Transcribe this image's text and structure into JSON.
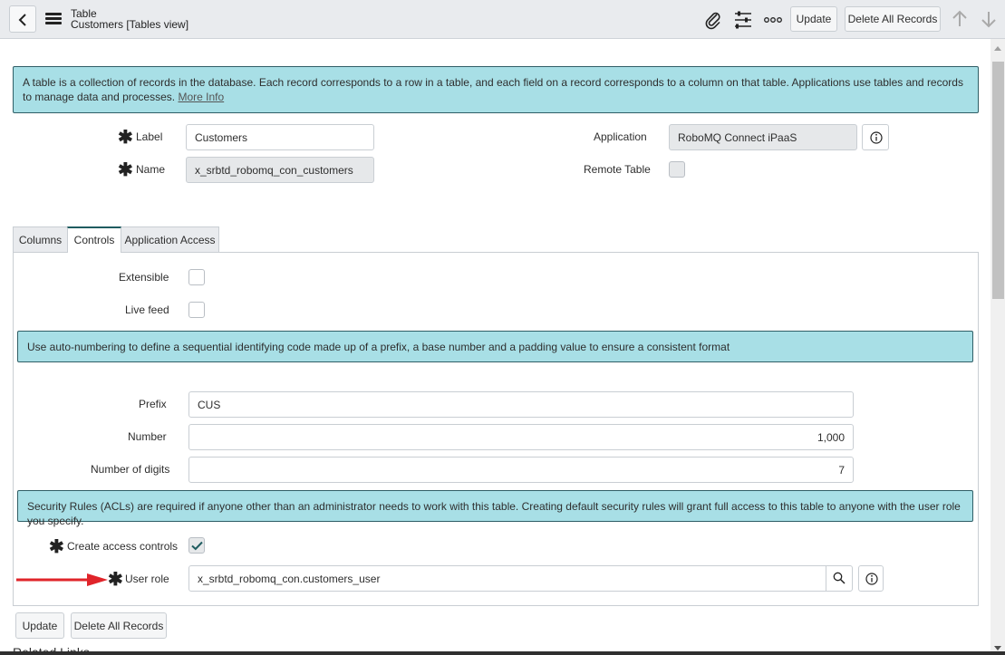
{
  "header": {
    "title": "Table",
    "subtitle": "Customers [Tables view]",
    "icons": [
      "back-icon",
      "menu-icon",
      "paperclip-icon",
      "sliders-icon",
      "more-icon",
      "arrow-up-icon",
      "arrow-down-icon"
    ],
    "update_label": "Update",
    "delete_all_label": "Delete All Records"
  },
  "info_top": {
    "text": "A table is a collection of records in the database. Each record corresponds to a row in a table, and each field on a record corresponds to a column on that table. Applications use tables and records to manage data and processes.",
    "link": "More Info"
  },
  "form": {
    "label_label": "Label",
    "label_value": "Customers",
    "name_label": "Name",
    "name_value": "x_srbtd_robomq_con_customers",
    "application_label": "Application",
    "application_value": "RoboMQ Connect iPaaS",
    "remote_table_label": "Remote Table",
    "remote_table_checked": false
  },
  "tabs": [
    {
      "label": "Columns",
      "active": false
    },
    {
      "label": "Controls",
      "active": true
    },
    {
      "label": "Application Access",
      "active": false
    }
  ],
  "controls": {
    "extensible_label": "Extensible",
    "extensible_checked": false,
    "live_feed_label": "Live feed",
    "live_feed_checked": false,
    "auto_number_info": "Use auto-numbering to define a sequential identifying code made up of a prefix, a base number and a padding value to ensure a consistent format",
    "prefix_label": "Prefix",
    "prefix_value": "CUS",
    "number_label": "Number",
    "number_value": "1,000",
    "digits_label": "Number of digits",
    "digits_value": "7",
    "acl_info": "Security Rules (ACLs) are required if anyone other than an administrator needs to work with this table. Creating default security rules will grant full access to this table to anyone with the user role you specify.",
    "create_access_label": "Create access controls",
    "create_access_checked": true,
    "user_role_label": "User role",
    "user_role_value": "x_srbtd_robomq_con.customers_user"
  },
  "footer": {
    "update_label": "Update",
    "delete_all_label": "Delete All Records",
    "related_links": "Related Links"
  },
  "colors": {
    "info_bg": "#a8dfe6",
    "info_border": "#2f5e66",
    "header_bg": "#e9ebee",
    "annotation_arrow": "#e0242a",
    "check": "#1f5c60"
  },
  "required_marker": "✱"
}
